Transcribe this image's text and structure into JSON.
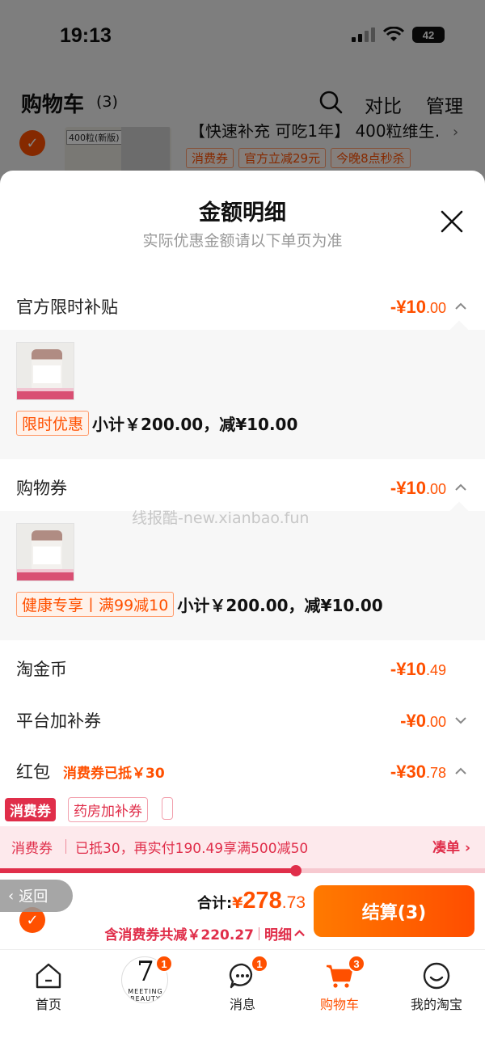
{
  "status": {
    "time": "19:13",
    "battery": "42"
  },
  "header": {
    "title": "购物车",
    "count": "(3)",
    "compare": "对比",
    "manage": "管理"
  },
  "bg_item": {
    "thumb_tag": "400粒(新版)",
    "title": "【快速补充 可吃1年】 400粒维生…",
    "tags": [
      "消费券",
      "官方立减29元",
      "今晚8点秒杀"
    ]
  },
  "sheet": {
    "title": "金额明细",
    "subtitle": "实际优惠金额请以下单页为准"
  },
  "sections": {
    "subsidy": {
      "label": "官方限时补贴",
      "amount_int": "-¥10",
      "amount_dec": ".00"
    },
    "subsidy_detail": {
      "tag": "限时优惠",
      "subtotal": "小计￥200.00，减¥10.00"
    },
    "coupon": {
      "label": "购物券",
      "amount_int": "-¥10",
      "amount_dec": ".00"
    },
    "coupon_detail": {
      "tag": "健康专享丨满99减10",
      "subtotal": "小计￥200.00，减¥10.00"
    },
    "coins": {
      "label": "淘金币",
      "amount_int": "-¥10",
      "amount_dec": ".49"
    },
    "platform": {
      "label": "平台加补券",
      "amount_int": "-¥0",
      "amount_dec": ".00"
    },
    "hongbao": {
      "label": "红包",
      "note": "消费券已抵￥30",
      "amount_int": "-¥30",
      "amount_dec": ".78"
    }
  },
  "chips": {
    "active": "消费券",
    "other": "药房加补券"
  },
  "banner": {
    "left": "消费券",
    "text": "已抵30，再实付190.49享满500减50",
    "link": "凑单 ›",
    "progress": 0.61
  },
  "checkout": {
    "back": "返回",
    "total_label": "合计:",
    "total_currency": "¥",
    "total_int": "278",
    "total_dec": ".73",
    "saving": "含消费券共减￥220.27",
    "detail": "明细",
    "button": "结算(3)"
  },
  "tabs": [
    {
      "label": "首页",
      "icon": "home-icon"
    },
    {
      "label": "",
      "icon": "promo-icon",
      "badge": "1",
      "promo_num": "7",
      "promo_txt": "MEETING BEAUTY"
    },
    {
      "label": "消息",
      "icon": "message-icon",
      "badge": "1"
    },
    {
      "label": "购物车",
      "icon": "cart-icon",
      "badge": "3"
    },
    {
      "label": "我的淘宝",
      "icon": "profile-icon"
    }
  ],
  "watermark": "线报酷-new.xianbao.fun",
  "colors": {
    "accent": "#ff5000",
    "promo_red": "#e02e4a"
  }
}
